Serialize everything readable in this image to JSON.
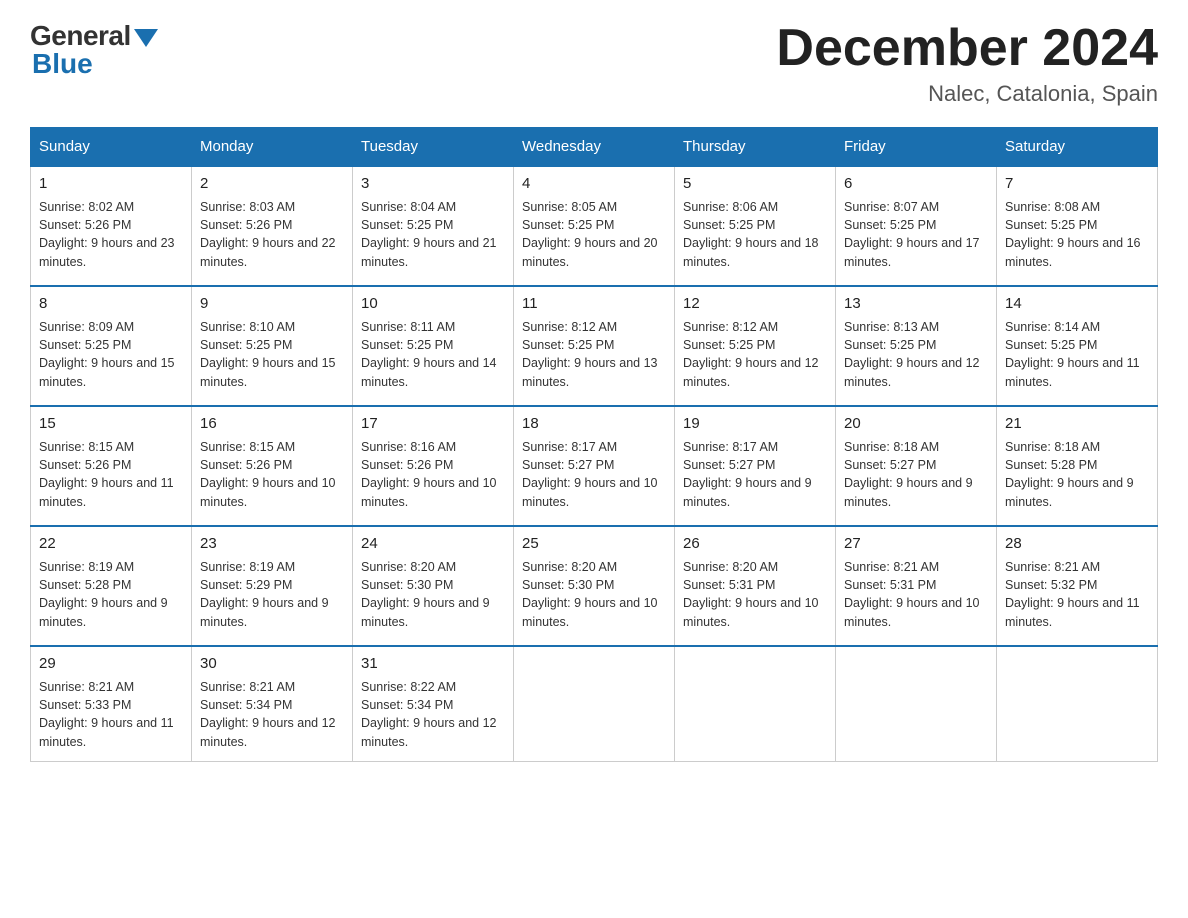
{
  "logo": {
    "general": "General",
    "blue": "Blue"
  },
  "title": "December 2024",
  "location": "Nalec, Catalonia, Spain",
  "days_of_week": [
    "Sunday",
    "Monday",
    "Tuesday",
    "Wednesday",
    "Thursday",
    "Friday",
    "Saturday"
  ],
  "weeks": [
    [
      {
        "day": "1",
        "sunrise": "8:02 AM",
        "sunset": "5:26 PM",
        "daylight": "9 hours and 23 minutes."
      },
      {
        "day": "2",
        "sunrise": "8:03 AM",
        "sunset": "5:26 PM",
        "daylight": "9 hours and 22 minutes."
      },
      {
        "day": "3",
        "sunrise": "8:04 AM",
        "sunset": "5:25 PM",
        "daylight": "9 hours and 21 minutes."
      },
      {
        "day": "4",
        "sunrise": "8:05 AM",
        "sunset": "5:25 PM",
        "daylight": "9 hours and 20 minutes."
      },
      {
        "day": "5",
        "sunrise": "8:06 AM",
        "sunset": "5:25 PM",
        "daylight": "9 hours and 18 minutes."
      },
      {
        "day": "6",
        "sunrise": "8:07 AM",
        "sunset": "5:25 PM",
        "daylight": "9 hours and 17 minutes."
      },
      {
        "day": "7",
        "sunrise": "8:08 AM",
        "sunset": "5:25 PM",
        "daylight": "9 hours and 16 minutes."
      }
    ],
    [
      {
        "day": "8",
        "sunrise": "8:09 AM",
        "sunset": "5:25 PM",
        "daylight": "9 hours and 15 minutes."
      },
      {
        "day": "9",
        "sunrise": "8:10 AM",
        "sunset": "5:25 PM",
        "daylight": "9 hours and 15 minutes."
      },
      {
        "day": "10",
        "sunrise": "8:11 AM",
        "sunset": "5:25 PM",
        "daylight": "9 hours and 14 minutes."
      },
      {
        "day": "11",
        "sunrise": "8:12 AM",
        "sunset": "5:25 PM",
        "daylight": "9 hours and 13 minutes."
      },
      {
        "day": "12",
        "sunrise": "8:12 AM",
        "sunset": "5:25 PM",
        "daylight": "9 hours and 12 minutes."
      },
      {
        "day": "13",
        "sunrise": "8:13 AM",
        "sunset": "5:25 PM",
        "daylight": "9 hours and 12 minutes."
      },
      {
        "day": "14",
        "sunrise": "8:14 AM",
        "sunset": "5:25 PM",
        "daylight": "9 hours and 11 minutes."
      }
    ],
    [
      {
        "day": "15",
        "sunrise": "8:15 AM",
        "sunset": "5:26 PM",
        "daylight": "9 hours and 11 minutes."
      },
      {
        "day": "16",
        "sunrise": "8:15 AM",
        "sunset": "5:26 PM",
        "daylight": "9 hours and 10 minutes."
      },
      {
        "day": "17",
        "sunrise": "8:16 AM",
        "sunset": "5:26 PM",
        "daylight": "9 hours and 10 minutes."
      },
      {
        "day": "18",
        "sunrise": "8:17 AM",
        "sunset": "5:27 PM",
        "daylight": "9 hours and 10 minutes."
      },
      {
        "day": "19",
        "sunrise": "8:17 AM",
        "sunset": "5:27 PM",
        "daylight": "9 hours and 9 minutes."
      },
      {
        "day": "20",
        "sunrise": "8:18 AM",
        "sunset": "5:27 PM",
        "daylight": "9 hours and 9 minutes."
      },
      {
        "day": "21",
        "sunrise": "8:18 AM",
        "sunset": "5:28 PM",
        "daylight": "9 hours and 9 minutes."
      }
    ],
    [
      {
        "day": "22",
        "sunrise": "8:19 AM",
        "sunset": "5:28 PM",
        "daylight": "9 hours and 9 minutes."
      },
      {
        "day": "23",
        "sunrise": "8:19 AM",
        "sunset": "5:29 PM",
        "daylight": "9 hours and 9 minutes."
      },
      {
        "day": "24",
        "sunrise": "8:20 AM",
        "sunset": "5:30 PM",
        "daylight": "9 hours and 9 minutes."
      },
      {
        "day": "25",
        "sunrise": "8:20 AM",
        "sunset": "5:30 PM",
        "daylight": "9 hours and 10 minutes."
      },
      {
        "day": "26",
        "sunrise": "8:20 AM",
        "sunset": "5:31 PM",
        "daylight": "9 hours and 10 minutes."
      },
      {
        "day": "27",
        "sunrise": "8:21 AM",
        "sunset": "5:31 PM",
        "daylight": "9 hours and 10 minutes."
      },
      {
        "day": "28",
        "sunrise": "8:21 AM",
        "sunset": "5:32 PM",
        "daylight": "9 hours and 11 minutes."
      }
    ],
    [
      {
        "day": "29",
        "sunrise": "8:21 AM",
        "sunset": "5:33 PM",
        "daylight": "9 hours and 11 minutes."
      },
      {
        "day": "30",
        "sunrise": "8:21 AM",
        "sunset": "5:34 PM",
        "daylight": "9 hours and 12 minutes."
      },
      {
        "day": "31",
        "sunrise": "8:22 AM",
        "sunset": "5:34 PM",
        "daylight": "9 hours and 12 minutes."
      },
      null,
      null,
      null,
      null
    ]
  ]
}
